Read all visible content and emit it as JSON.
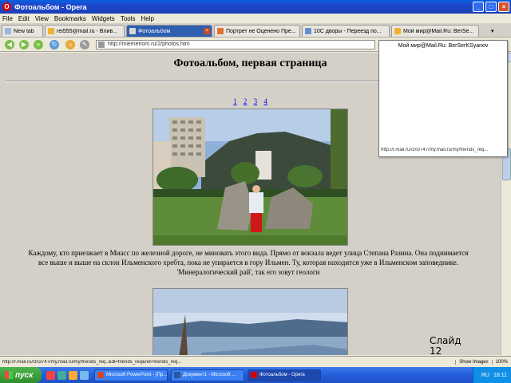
{
  "window": {
    "title": "Фотоальбом - Opera"
  },
  "menu": [
    "File",
    "Edit",
    "View",
    "Bookmarks",
    "Widgets",
    "Tools",
    "Help"
  ],
  "tabs": [
    {
      "label": "New tab",
      "active": false
    },
    {
      "label": "rei555@mail.ru - Влив...",
      "active": false
    },
    {
      "label": "Фотоальбом",
      "active": true
    },
    {
      "label": "Портрет не Оценено Пре...",
      "active": false
    },
    {
      "label": "10С дворы - Переезд по...",
      "active": false
    },
    {
      "label": "Мой мир@Mail.Ru: BerSe...",
      "active": false
    }
  ],
  "address": {
    "url": "http://miemeriom.ru/2/photos.htm"
  },
  "page": {
    "title": "Фотоальбом, первая страница",
    "pages": [
      "1",
      "2",
      "3",
      "4"
    ],
    "caption_line1": "Каждому, кто приезжает в Миасс по железной дороге, не миновать этого вида. Прямо от вокзала ведет улица Степана Разина. Она поднимается",
    "caption_line2": "все выше и выше на склон Ильменского хребта, пока не упирается в гору Ильмен. Ту, которая находится уже в Ильменском заповеднике.",
    "caption_line3": "'Минералогический рай', так его зовут геологи"
  },
  "popup": {
    "title": "Мой мир@Mail.Ru: BerSerKSyanov",
    "url": "http://r.mail.ru/cln3747/my.mail.ru/my/friends_req..."
  },
  "slide": {
    "label_line1": "Слайд",
    "label_line2": "12"
  },
  "status": {
    "url": "http://r.mail.ru/cln3747/my.mail.ru/my/friends_req..&dl=friends_req&ret=friends_req...",
    "images": "Show Images",
    "zoom": "100%"
  },
  "taskbar": {
    "start": "пуск",
    "items": [
      {
        "label": "Microsoft PowerPoint - [Пр...",
        "active": false,
        "color": "#D24726"
      },
      {
        "label": "Документ1 - Microsoft ...",
        "active": false,
        "color": "#2B579A"
      },
      {
        "label": "Фотоальбом - Opera",
        "active": true,
        "color": "#D40000"
      }
    ],
    "lang": "RU",
    "clock": "18:11"
  }
}
